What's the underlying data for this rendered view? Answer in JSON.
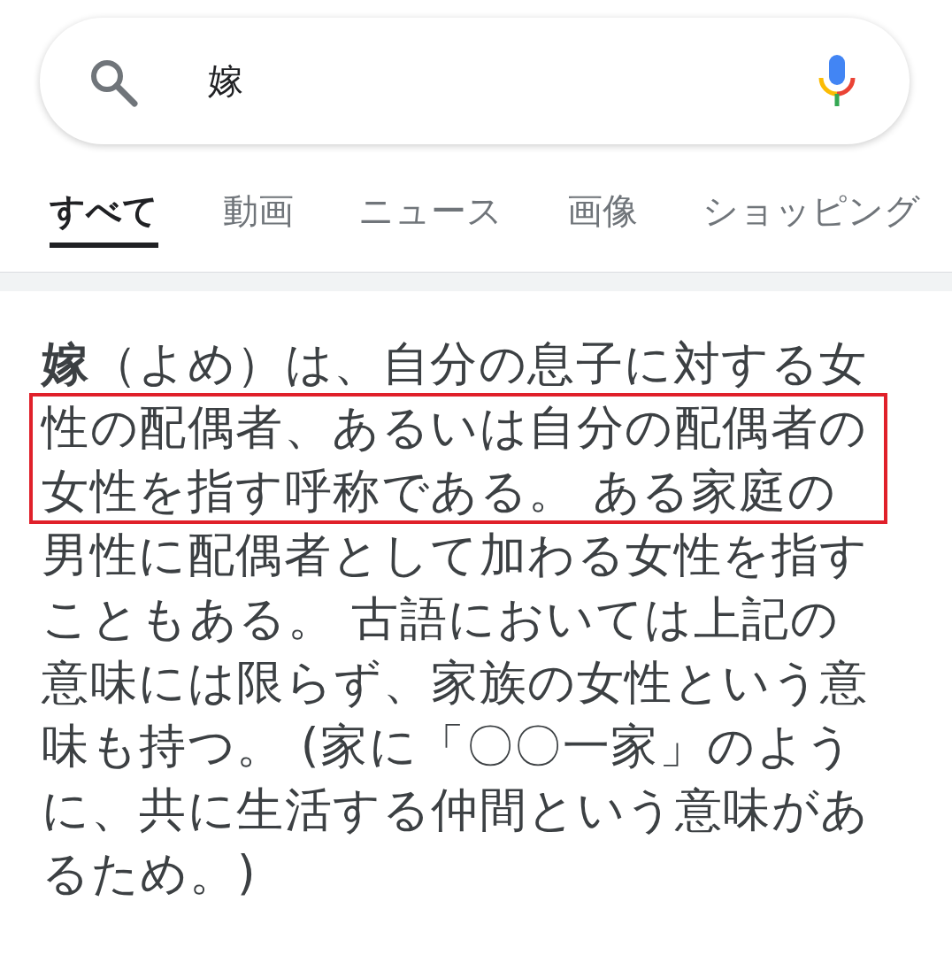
{
  "search": {
    "value": "嫁"
  },
  "tabs": [
    {
      "label": "すべて",
      "selected": true
    },
    {
      "label": "動画",
      "selected": false
    },
    {
      "label": "ニュース",
      "selected": false
    },
    {
      "label": "画像",
      "selected": false
    },
    {
      "label": "ショッピング",
      "selected": false
    }
  ],
  "result": {
    "text": "**嫁**（よめ）は、自分の息子に対する女性の配偶者、あるいは自分の配偶者の女性を指す呼称である。 ある家庭の男性に配偶者として加わる女性を指すこともある。 古語においては上記の意味には限らず、家族の女性という意味も持つ。 (家に「〇〇一家」のように、共に生活する仲間という意味があるため。)",
    "annotation": {
      "kind": "rectangle",
      "color": "#e0202a"
    }
  }
}
